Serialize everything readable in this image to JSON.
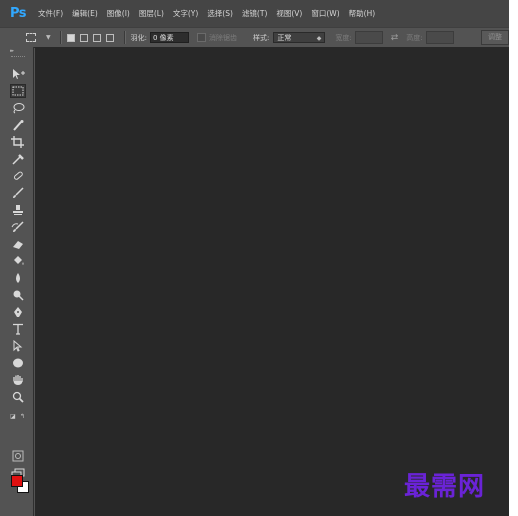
{
  "app": {
    "logo": "Ps"
  },
  "menu": [
    "文件(F)",
    "编辑(E)",
    "图像(I)",
    "图层(L)",
    "文字(Y)",
    "选择(S)",
    "滤镜(T)",
    "视图(V)",
    "窗口(W)",
    "帮助(H)"
  ],
  "options": {
    "feather_label": "羽化:",
    "feather_value": "0 像素",
    "antialias_label": "消除锯齿",
    "style_label": "样式:",
    "style_value": "正常",
    "width_label": "宽度:",
    "height_label": "高度:",
    "refine_label": "调整"
  },
  "toolbar": {
    "collapse_glyph": "▸▸",
    "tools": [
      "move-tool",
      "rectangular-marquee-tool",
      "lasso-tool",
      "quick-selection-tool",
      "crop-tool",
      "eyedropper-tool",
      "spot-healing-brush-tool",
      "brush-tool",
      "clone-stamp-tool",
      "history-brush-tool",
      "eraser-tool",
      "paint-bucket-tool",
      "blur-tool",
      "dodge-tool",
      "pen-tool",
      "type-tool",
      "path-selection-tool",
      "ellipse-tool",
      "hand-tool",
      "zoom-tool"
    ],
    "foreground_color": "#e01010",
    "background_color": "#ffffff"
  },
  "watermark": "最需网",
  "colors": {
    "menubar": "#454545",
    "panel": "#535353",
    "canvas": "#282828",
    "logo": "#31a8ff",
    "watermark": "#6a23d6"
  }
}
